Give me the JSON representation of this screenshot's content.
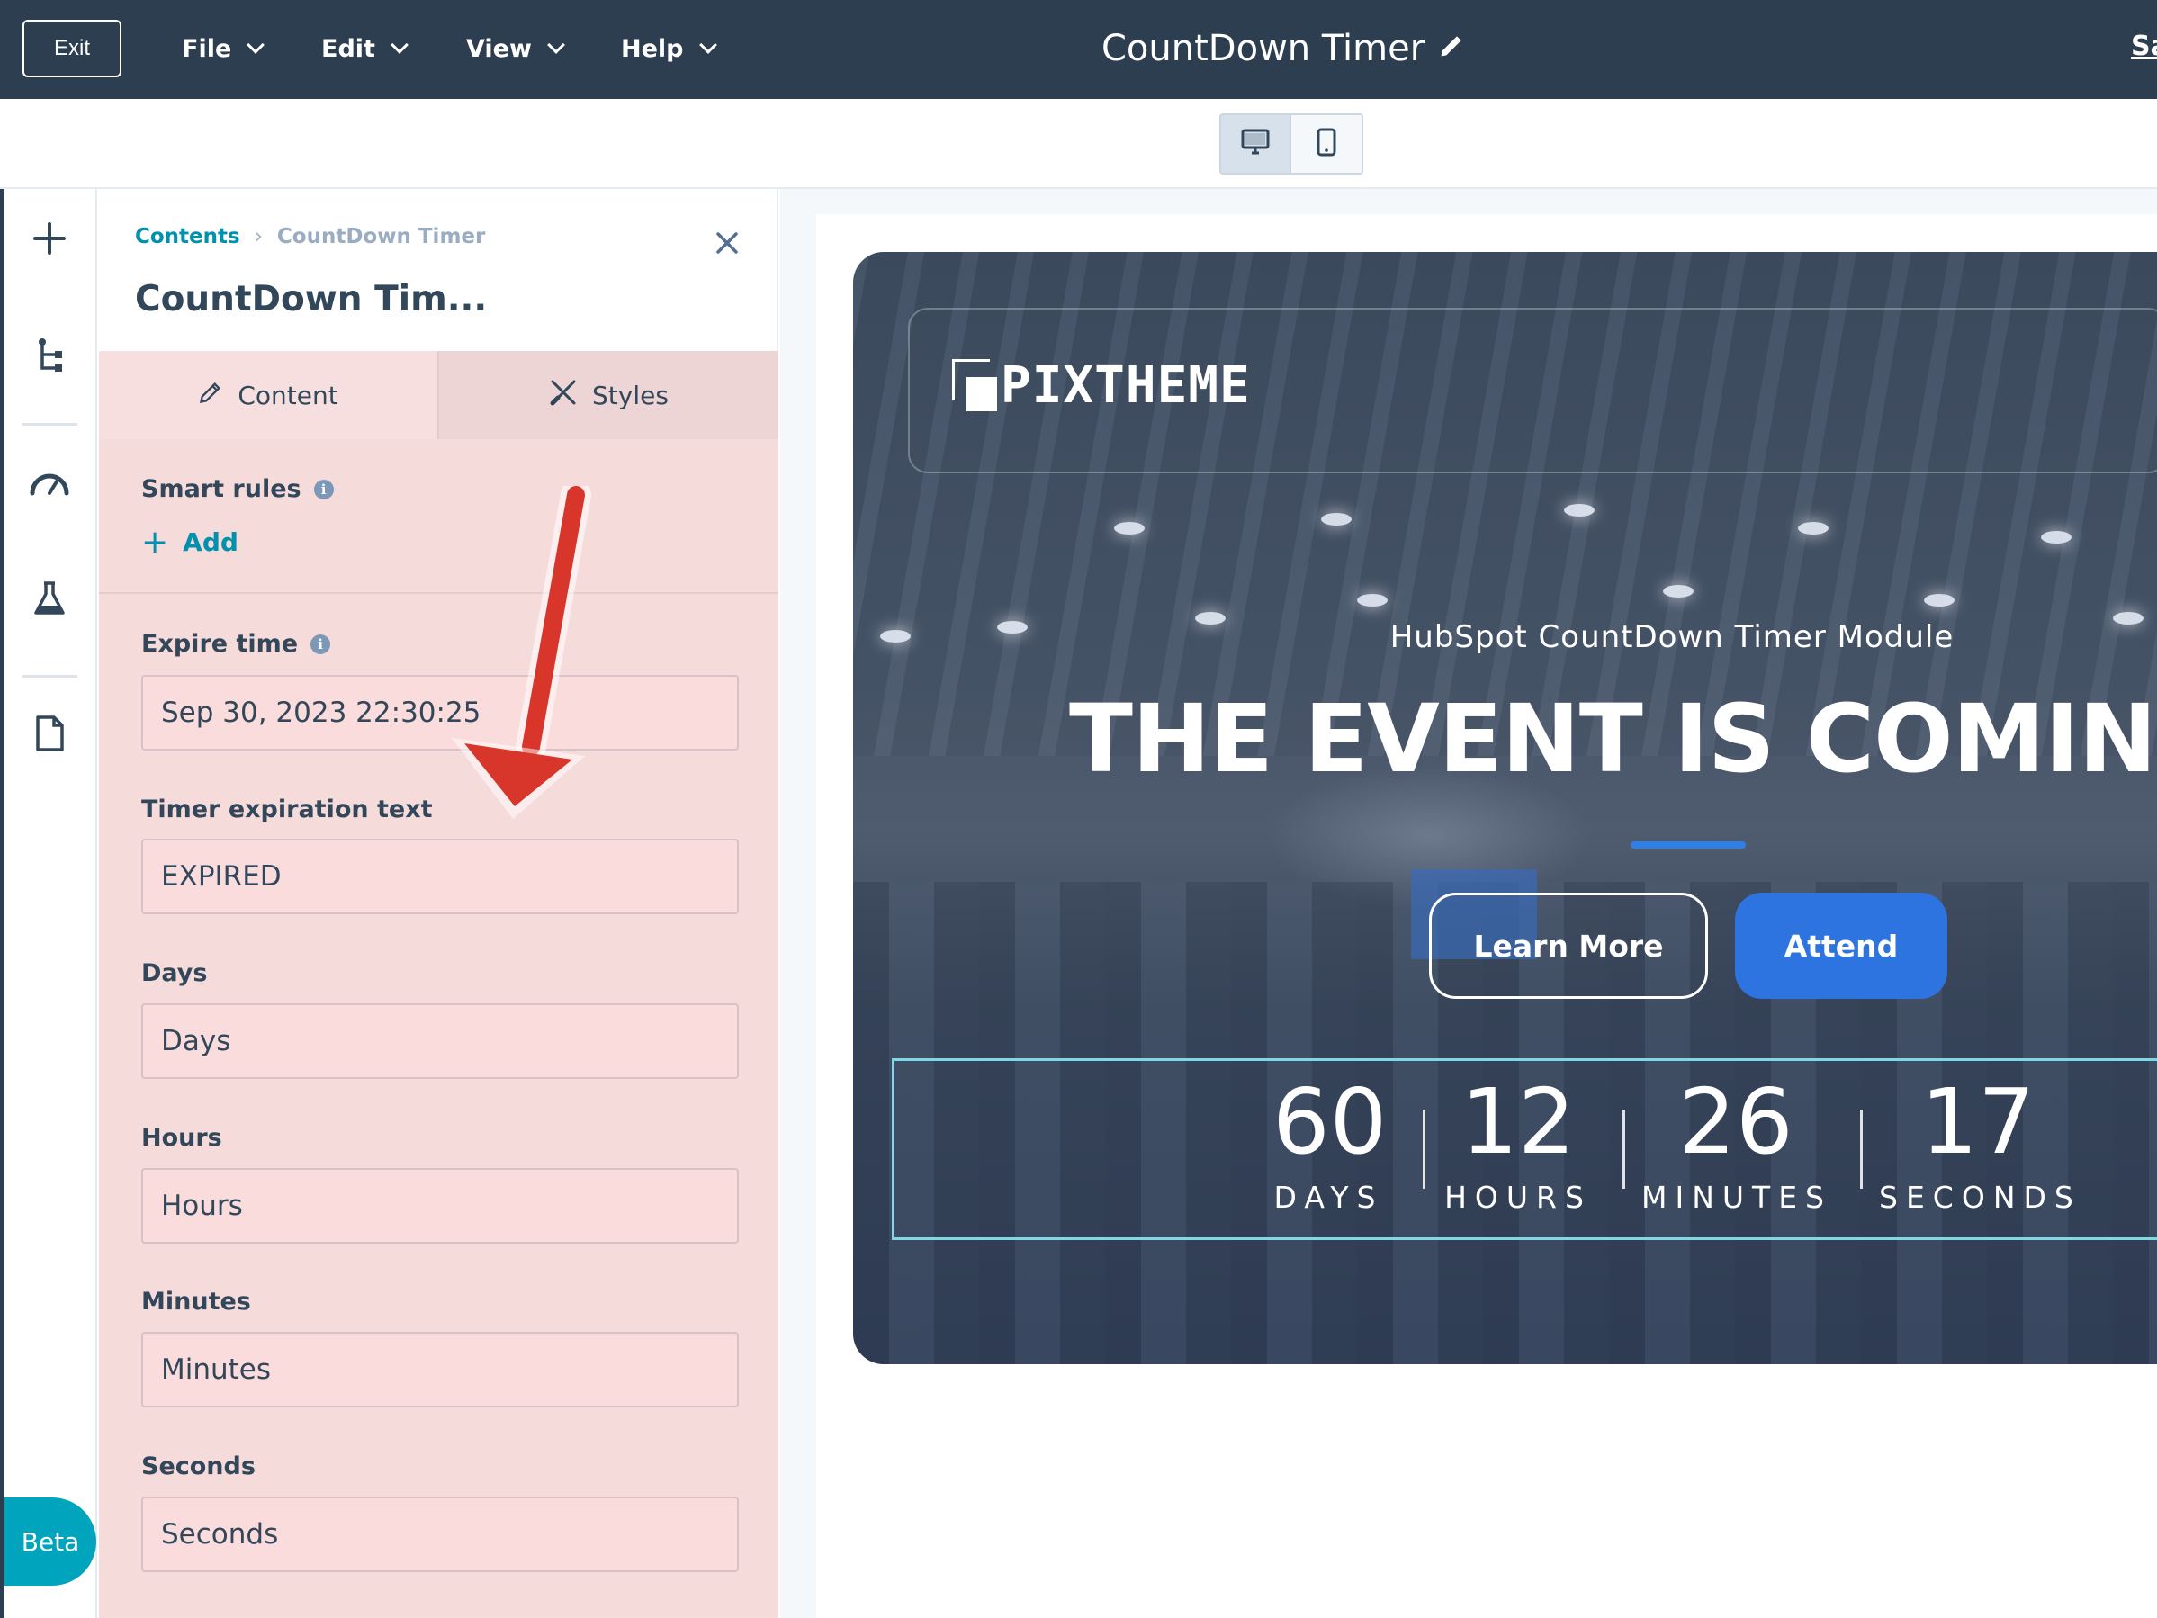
{
  "topbar": {
    "exit_label": "Exit",
    "menu": [
      {
        "label": "File"
      },
      {
        "label": "Edit"
      },
      {
        "label": "View"
      },
      {
        "label": "Help"
      }
    ],
    "doc_title": "CountDown Timer",
    "save_label": "Sa"
  },
  "toolbar": {
    "devices": [
      {
        "icon": "desktop-icon",
        "active": true
      },
      {
        "icon": "mobile-icon",
        "active": false
      }
    ]
  },
  "leftbar": {
    "icons": [
      "plus-icon",
      "tree-icon",
      "speedometer-icon",
      "flask-icon",
      "page-icon"
    ],
    "beta_label": "Beta"
  },
  "panel": {
    "breadcrumb": {
      "root": "Contents",
      "separator": "›",
      "current": "CountDown Timer"
    },
    "title": "CountDown Tim...",
    "tabs": [
      {
        "label": "Content",
        "icon": "pencil-icon",
        "active": true
      },
      {
        "label": "Styles",
        "icon": "styles-icon",
        "active": false
      }
    ],
    "smart_rules": {
      "label": "Smart rules",
      "add_label": "Add"
    },
    "fields": [
      {
        "label": "Expire time",
        "value": "Sep 30, 2023 22:30:25",
        "info": true
      },
      {
        "label": "Timer expiration text",
        "value": "EXPIRED"
      },
      {
        "label": "Days",
        "value": "Days"
      },
      {
        "label": "Hours",
        "value": "Hours"
      },
      {
        "label": "Minutes",
        "value": "Minutes"
      },
      {
        "label": "Seconds",
        "value": "Seconds"
      }
    ]
  },
  "preview": {
    "logo_text": "PIXTHEME",
    "subtitle": "HubSpot CountDown Timer Module",
    "headline": "THE EVENT IS COMING SO",
    "buttons": {
      "learn_more": "Learn More",
      "attend": "Attend"
    },
    "accent_color": "#2e74e0",
    "timer": [
      {
        "value": "60",
        "label": "DAYS"
      },
      {
        "value": "12",
        "label": "HOURS"
      },
      {
        "value": "26",
        "label": "MINUTES"
      },
      {
        "value": "17",
        "label": "SECONDS"
      }
    ]
  }
}
